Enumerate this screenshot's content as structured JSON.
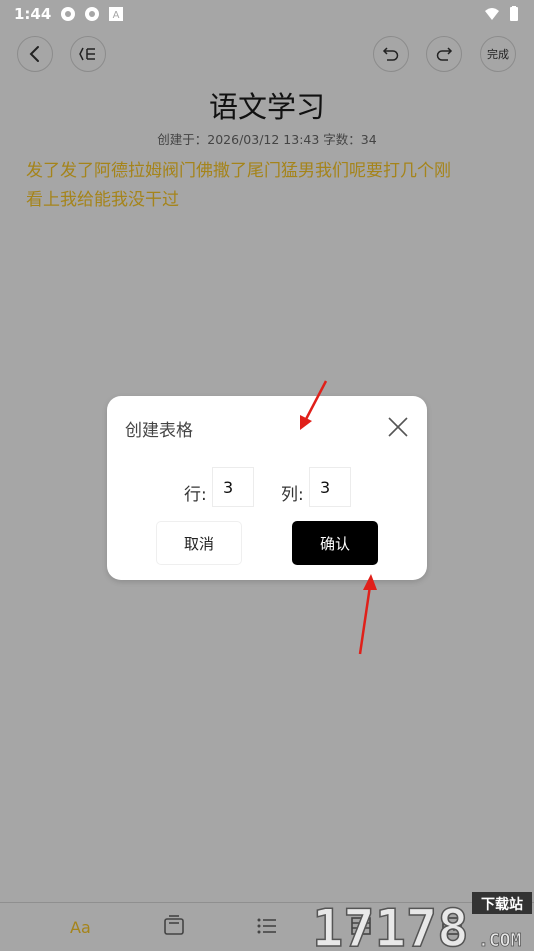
{
  "status_bar": {
    "time": "1:44",
    "left_icons": [
      "sync-icon",
      "sync-icon",
      "a-box-icon"
    ],
    "right_icons": [
      "wifi-icon",
      "battery-icon"
    ]
  },
  "toolbar": {
    "back_icon": "chevron-left-icon",
    "outline_icon": "outline-list-icon",
    "undo_icon": "undo-icon",
    "redo_icon": "redo-icon",
    "done_label": "完成"
  },
  "note": {
    "title": "语文学习",
    "meta": "创建于：2026/03/12 13:43  字数：34",
    "body_line1": "发了发了阿德拉姆阀门佛撒了尾门猛男我们呢要打几个刚",
    "body_line2": "看上我给能我没干过",
    "text_color": "#a5841a"
  },
  "dialog": {
    "title": "创建表格",
    "row_label": "行:",
    "row_value": "3",
    "col_label": "列:",
    "col_value": "3",
    "cancel_label": "取消",
    "confirm_label": "确认"
  },
  "bottom_bar": {
    "font_label": "Aa",
    "icons": [
      "text-size-icon",
      "box-icon",
      "bullet-list-icon",
      "table-icon",
      "image-icon"
    ]
  },
  "watermark": {
    "text_top": "下载站",
    "text_main": "17178",
    "text_sub": ".COM"
  },
  "colors": {
    "overlay_bg": "#a6a6a6",
    "accent_gold": "#a5841a",
    "confirm_bg": "#000000",
    "annotation_arrow": "#e0201a"
  }
}
